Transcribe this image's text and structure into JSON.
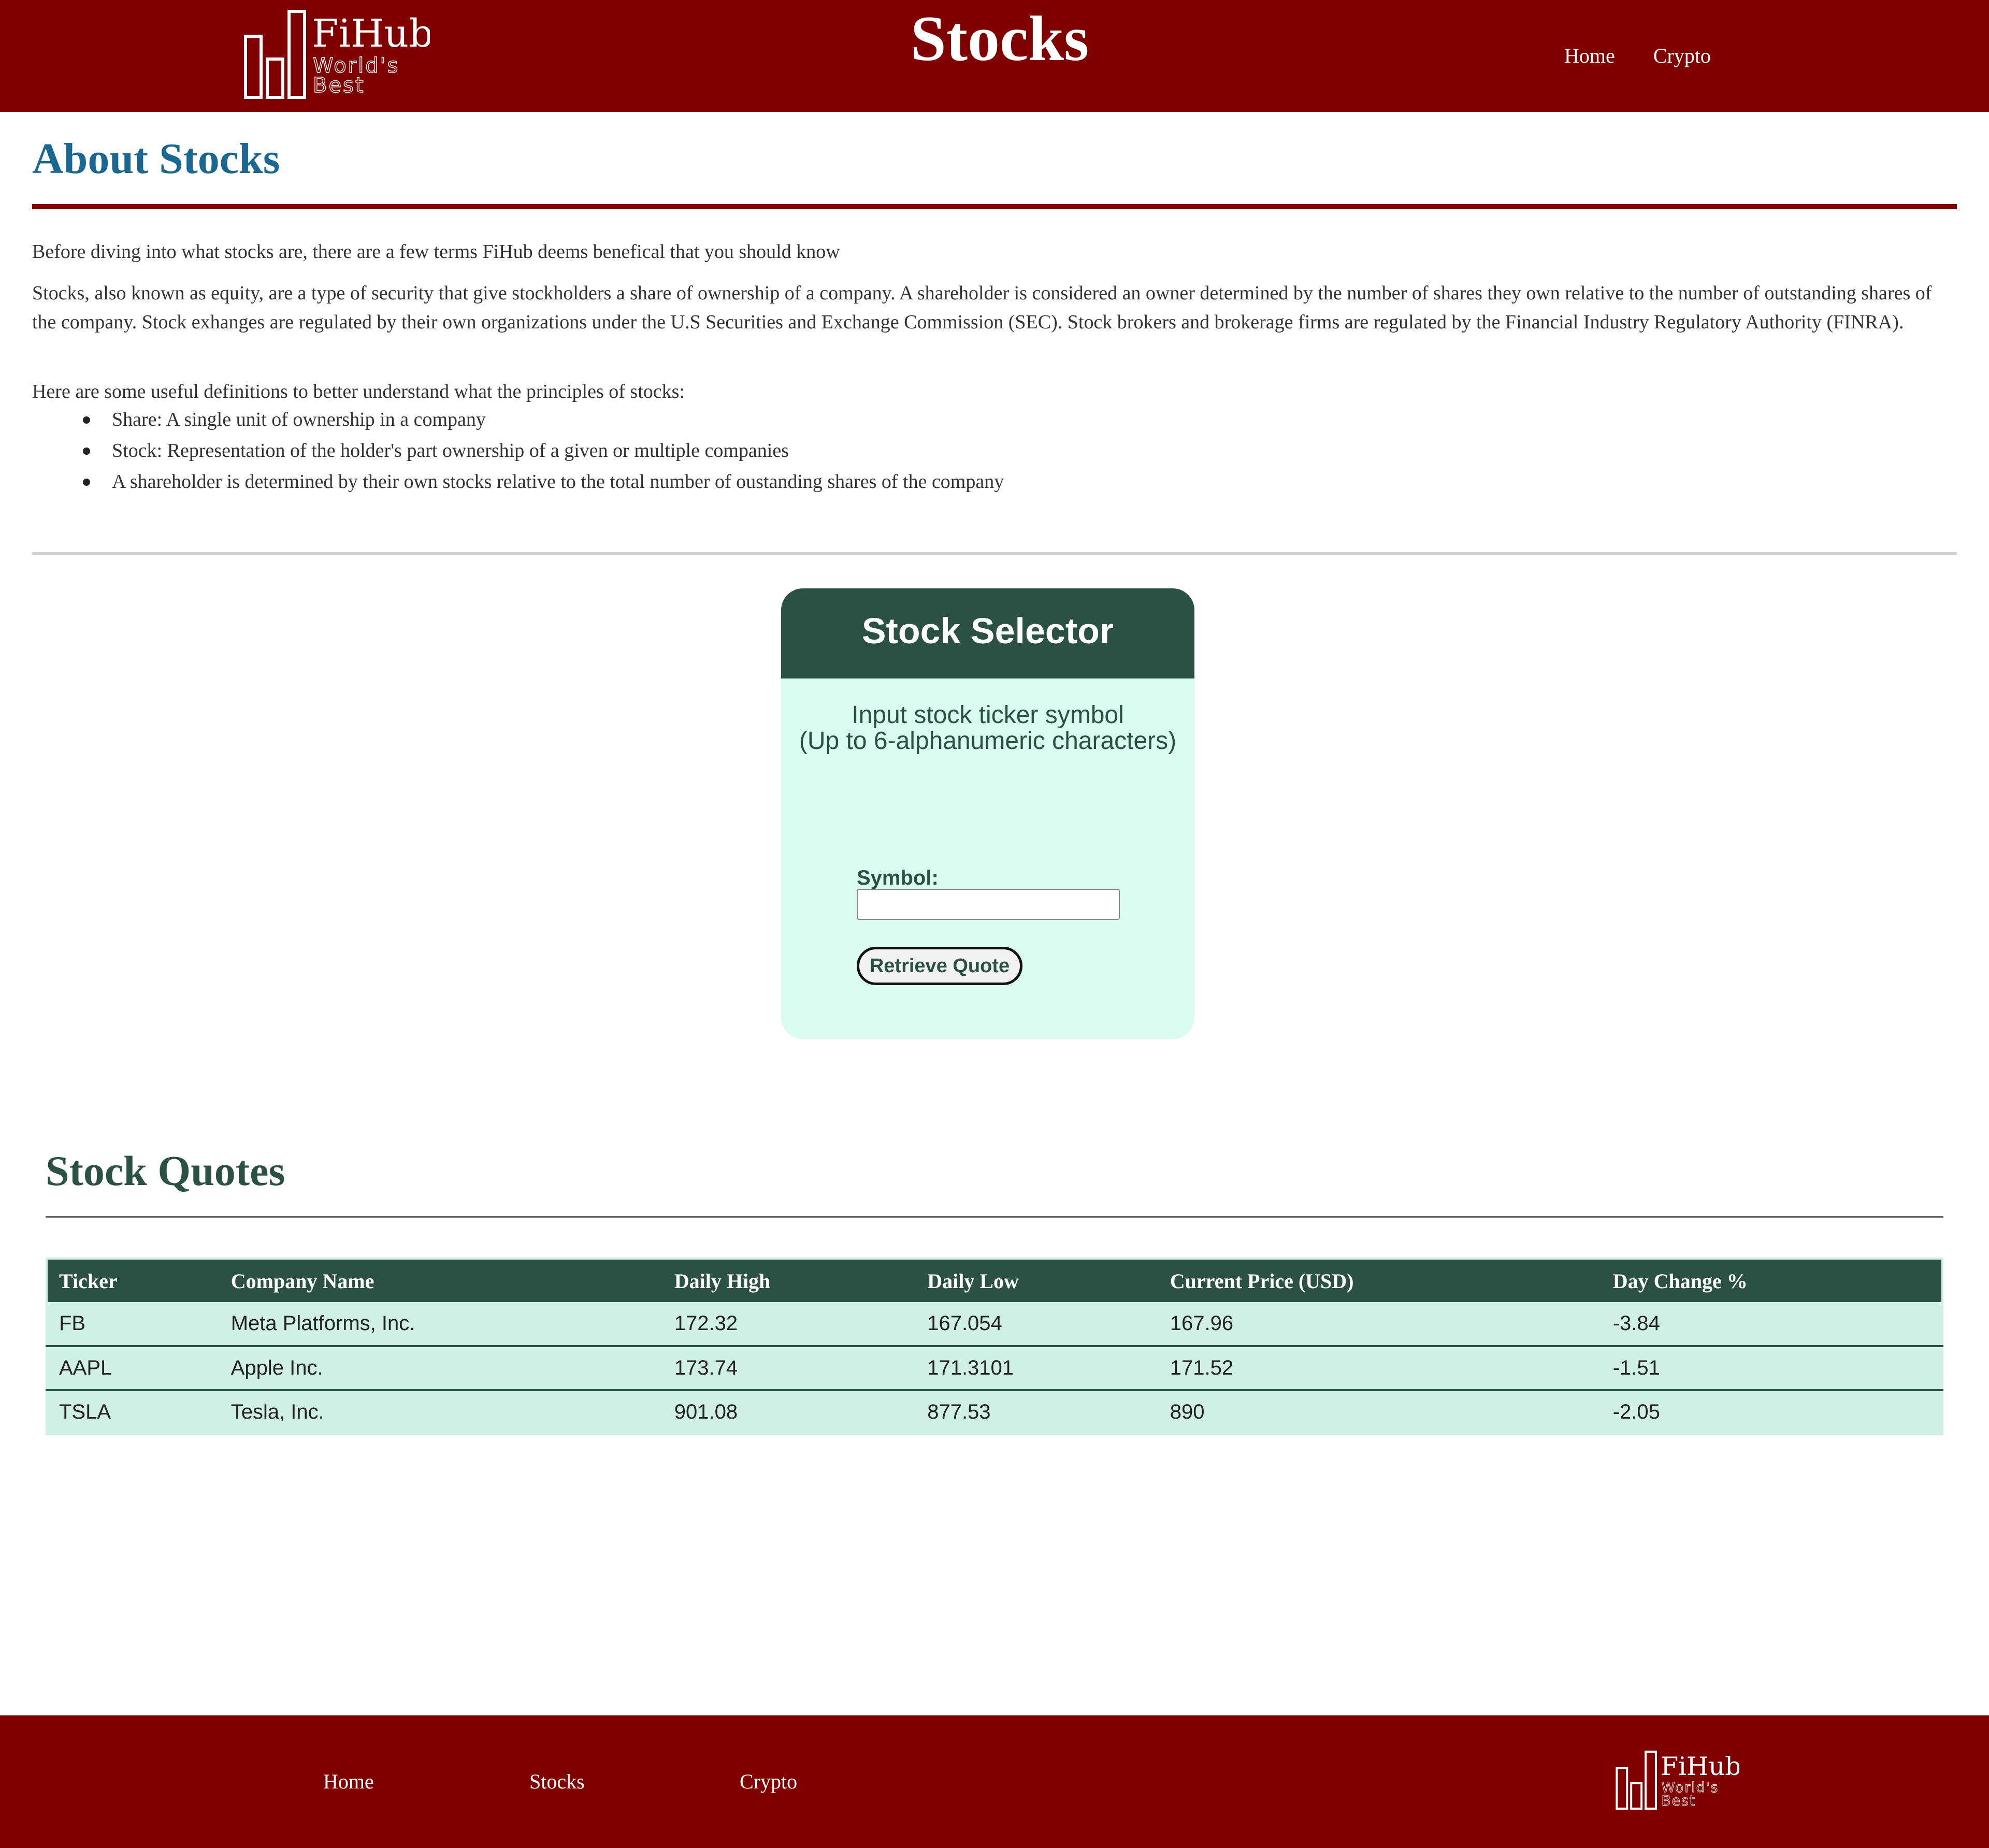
{
  "header": {
    "logo": {
      "name": "FiHub",
      "tagline_line1": "World's",
      "tagline_line2": "Best"
    },
    "title": "Stocks",
    "nav": [
      "Home",
      "Crypto"
    ]
  },
  "about": {
    "title": "About Stocks",
    "paragraph1": "Before diving into what stocks are, there are a few terms FiHub deems benefical that you should know",
    "paragraph2": "Stocks, also known as equity, are a type of security that give stockholders a share of ownership of a company. A shareholder is considered an owner determined by the number of shares they own relative to the number of outstanding shares of the company. Stock exhanges are regulated by their own organizations under the U.S Securities and Exchange Commission (SEC). Stock brokers and brokerage firms are regulated by the Financial Industry Regulatory Authority (FINRA).",
    "paragraph3": "Here are some useful definitions to better understand what the principles of stocks:",
    "definitions": [
      "Share: A single unit of ownership in a company",
      "Stock: Representation of the holder's part ownership of a given or multiple companies",
      "A shareholder is determined by their own stocks relative to the total number of oustanding shares of the company"
    ]
  },
  "selector": {
    "title": "Stock Selector",
    "desc_line1": "Input stock ticker symbol",
    "desc_line2": "(Up to 6-alphanumeric characters)",
    "symbol_label": "Symbol:",
    "symbol_value": "",
    "button": "Retrieve Quote"
  },
  "quotes": {
    "title": "Stock Quotes",
    "columns": [
      "Ticker",
      "Company Name",
      "Daily High",
      "Daily Low",
      "Current Price (USD)",
      "Day Change %"
    ],
    "rows": [
      [
        "FB",
        "Meta Platforms, Inc.",
        "172.32",
        "167.054",
        "167.96",
        "-3.84"
      ],
      [
        "AAPL",
        "Apple Inc.",
        "173.74",
        "171.3101",
        "171.52",
        "-1.51"
      ],
      [
        "TSLA",
        "Tesla, Inc.",
        "901.08",
        "877.53",
        "890",
        "-2.05"
      ]
    ]
  },
  "footer": {
    "nav": [
      "Home",
      "Stocks",
      "Crypto"
    ]
  },
  "colors": {
    "brand": "#800000",
    "about_title": "#1a6792",
    "dark_green": "#2b5044",
    "card_bg": "#dafbf0",
    "table_row": "#d0f0e5"
  }
}
